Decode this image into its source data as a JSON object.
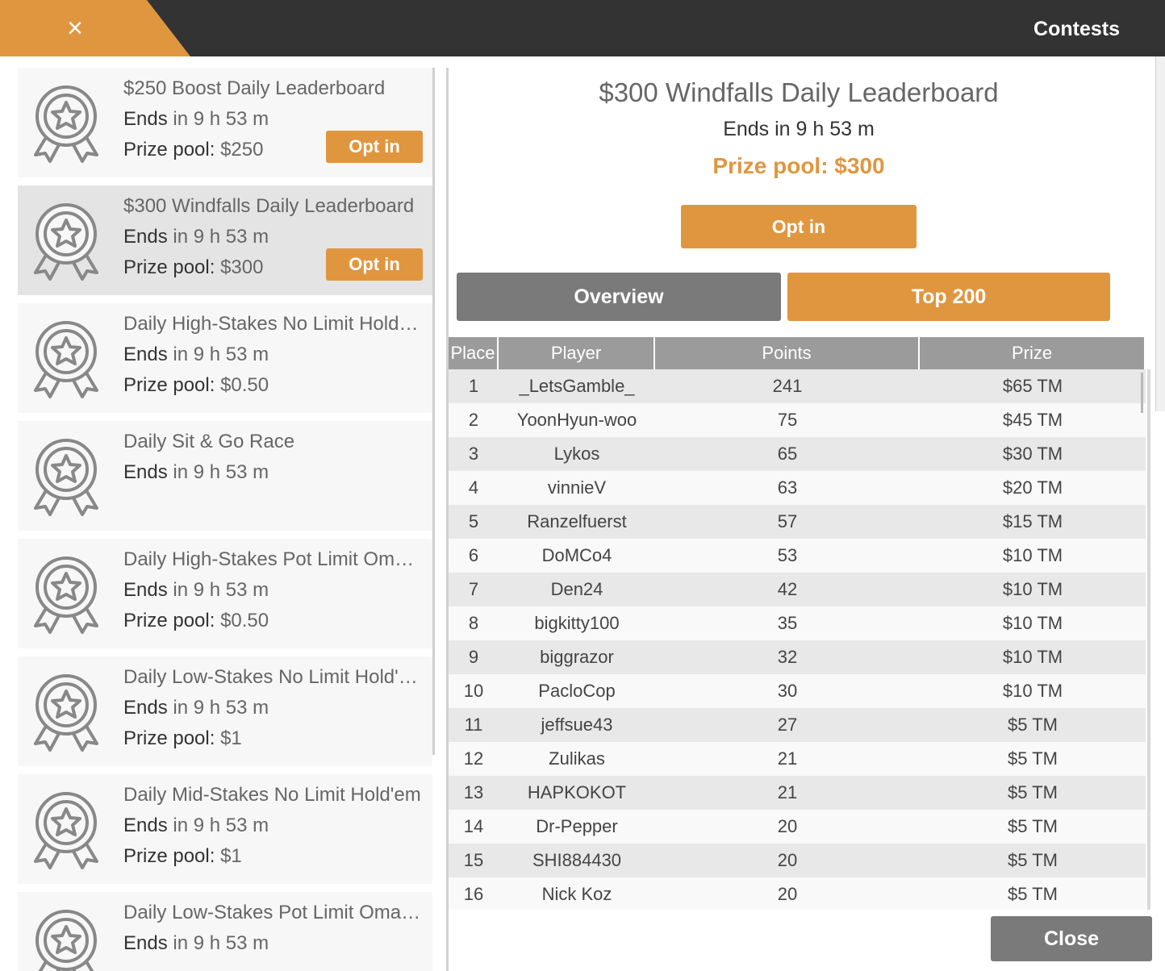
{
  "header": {
    "close_symbol": "×",
    "title": "Contests",
    "accent_color": "#e0963f",
    "bar_color": "#333333"
  },
  "contests": [
    {
      "title": "$250 Boost Daily Leaderboard",
      "ends_label": "Ends",
      "ends_value": "in 9 h 53 m",
      "prize_label": "Prize pool:",
      "prize_value": "$250",
      "button": "Opt in",
      "selected": false
    },
    {
      "title": "$300 Windfalls Daily Leaderboard",
      "ends_label": "Ends",
      "ends_value": "in 9 h 53 m",
      "prize_label": "Prize pool:",
      "prize_value": "$300",
      "button": "Opt in",
      "selected": true
    },
    {
      "title": "Daily High-Stakes No Limit Hold'em",
      "ends_label": "Ends",
      "ends_value": "in 9 h 53 m",
      "prize_label": "Prize pool:",
      "prize_value": "$0.50",
      "button": "",
      "selected": false
    },
    {
      "title": "Daily Sit & Go Race",
      "ends_label": "Ends",
      "ends_value": "in 9 h 53 m",
      "prize_label": "",
      "prize_value": "",
      "button": "",
      "selected": false
    },
    {
      "title": "Daily High-Stakes Pot Limit Omaha",
      "ends_label": "Ends",
      "ends_value": "in 9 h 53 m",
      "prize_label": "Prize pool:",
      "prize_value": "$0.50",
      "button": "",
      "selected": false
    },
    {
      "title": "Daily Low-Stakes No Limit Hold'em",
      "ends_label": "Ends",
      "ends_value": "in 9 h 53 m",
      "prize_label": "Prize pool:",
      "prize_value": "$1",
      "button": "",
      "selected": false
    },
    {
      "title": "Daily Mid-Stakes No Limit Hold'em",
      "ends_label": "Ends",
      "ends_value": "in 9 h 53 m",
      "prize_label": "Prize pool:",
      "prize_value": "$1",
      "button": "",
      "selected": false
    },
    {
      "title": "Daily Low-Stakes Pot Limit Omaha",
      "ends_label": "Ends",
      "ends_value": "in 9 h 53 m",
      "prize_label": "",
      "prize_value": "",
      "button": "",
      "selected": false
    }
  ],
  "detail": {
    "title": "$300 Windfalls Daily Leaderboard",
    "ends": "Ends in 9 h 53 m",
    "prize": "Prize pool: $300",
    "opt_in": "Opt in",
    "tabs": [
      {
        "label": "Overview",
        "active": false
      },
      {
        "label": "Top 200",
        "active": true
      }
    ],
    "columns": [
      "Place",
      "Player",
      "Points",
      "Prize"
    ],
    "rows": [
      [
        "1",
        "_LetsGamble_",
        "241",
        "$65 TM"
      ],
      [
        "2",
        "YoonHyun-woo",
        "75",
        "$45 TM"
      ],
      [
        "3",
        "Lykos",
        "65",
        "$30 TM"
      ],
      [
        "4",
        "vinnieV",
        "63",
        "$20 TM"
      ],
      [
        "5",
        "Ranzelfuerst",
        "57",
        "$15 TM"
      ],
      [
        "6",
        "DoMCo4",
        "53",
        "$10 TM"
      ],
      [
        "7",
        "Den24",
        "42",
        "$10 TM"
      ],
      [
        "8",
        "bigkitty100",
        "35",
        "$10 TM"
      ],
      [
        "9",
        "biggrazor",
        "32",
        "$10 TM"
      ],
      [
        "10",
        "PacloCop",
        "30",
        "$10 TM"
      ],
      [
        "11",
        "jeffsue43",
        "27",
        "$5 TM"
      ],
      [
        "12",
        "Zulikas",
        "21",
        "$5 TM"
      ],
      [
        "13",
        "HAPKOKOT",
        "21",
        "$5 TM"
      ],
      [
        "14",
        "Dr-Pepper",
        "20",
        "$5 TM"
      ],
      [
        "15",
        "SHI884430",
        "20",
        "$5 TM"
      ],
      [
        "16",
        "Nick Koz",
        "20",
        "$5 TM"
      ]
    ],
    "close": "Close"
  }
}
